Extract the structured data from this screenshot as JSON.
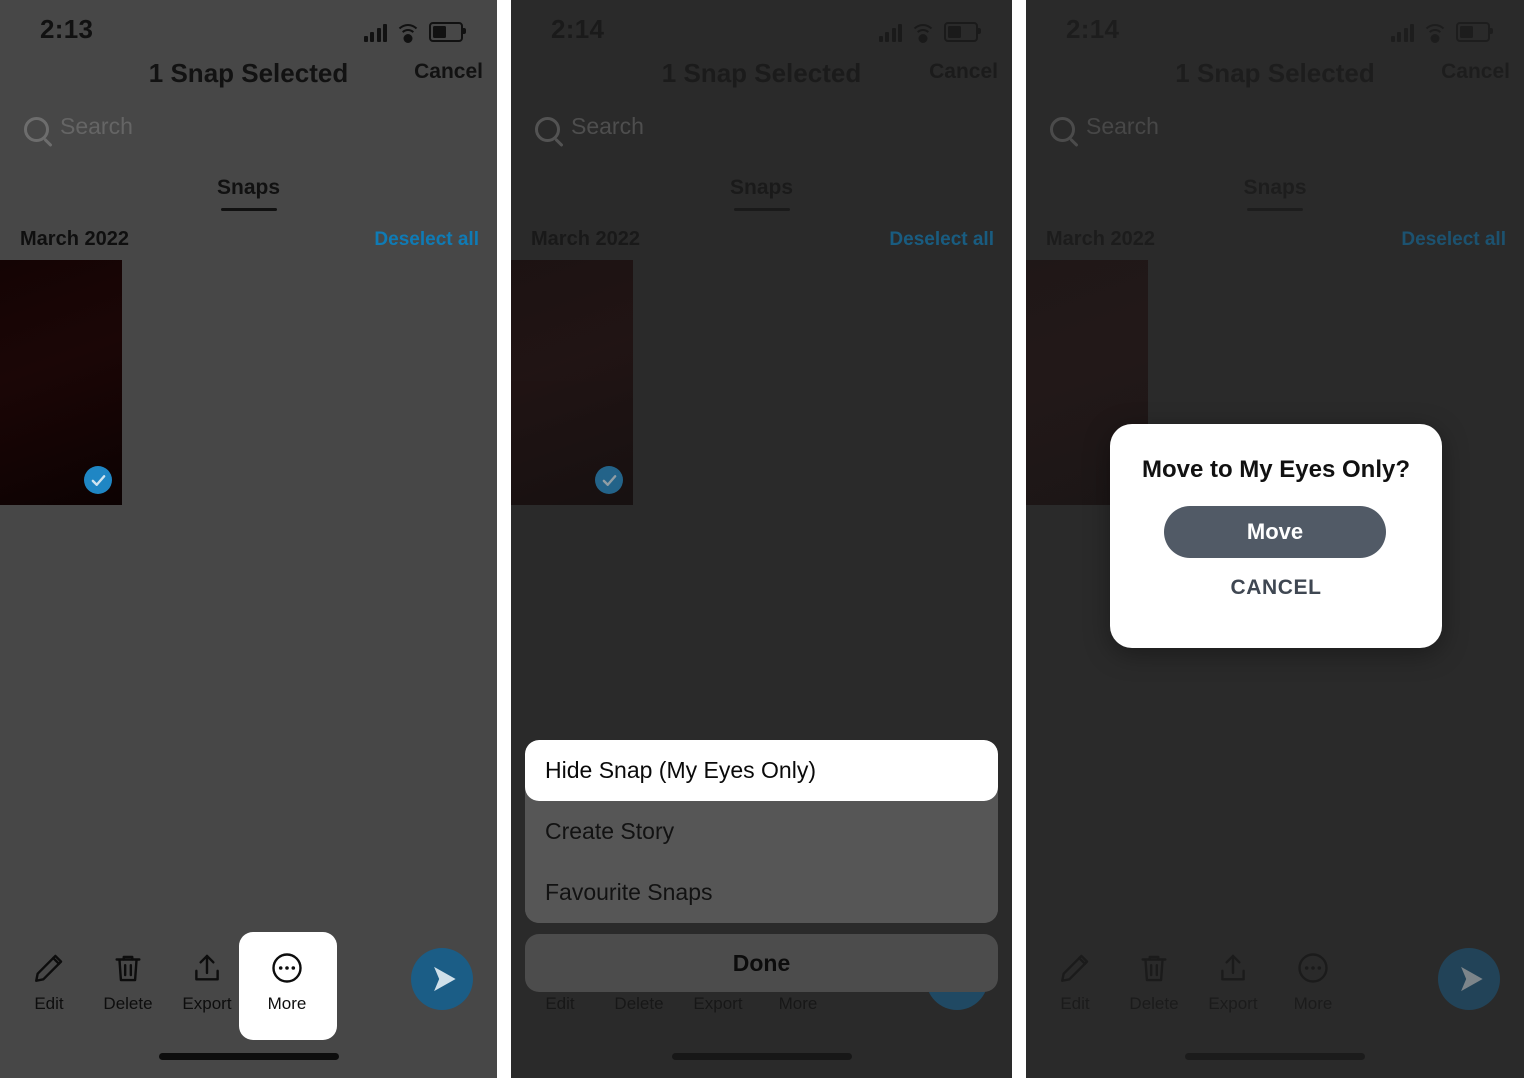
{
  "panels": [
    {
      "id": "panel-1",
      "status": {
        "time": "2:13",
        "signal_icon": "cellular-bars-icon",
        "wifi_icon": "wifi-icon",
        "battery_icon": "battery-icon"
      },
      "nav": {
        "title": "1 Snap Selected",
        "cancel_label": "Cancel"
      },
      "search": {
        "placeholder": "Search",
        "icon": "search-icon"
      },
      "tab": {
        "label": "Snaps"
      },
      "section": {
        "month": "March 2022",
        "deselect_label": "Deselect all"
      },
      "thumbnail": {
        "selected": true,
        "check_icon": "checkmark-icon"
      },
      "toolbar": {
        "items": [
          {
            "label": "Edit",
            "icon": "pencil-icon"
          },
          {
            "label": "Delete",
            "icon": "trash-icon"
          },
          {
            "label": "Export",
            "icon": "share-upload-icon"
          },
          {
            "label": "More",
            "icon": "ellipsis-circle-icon"
          }
        ],
        "send_icon": "send-arrow-icon",
        "highlighted": "More"
      }
    },
    {
      "id": "panel-2",
      "status": {
        "time": "2:14"
      },
      "nav": {
        "title": "1 Snap Selected",
        "cancel_label": "Cancel"
      },
      "search": {
        "placeholder": "Search"
      },
      "tab": {
        "label": "Snaps"
      },
      "section": {
        "month": "March 2022",
        "deselect_label": "Deselect all"
      },
      "sheet": {
        "items": [
          {
            "label": "Hide Snap (My Eyes Only)",
            "highlighted": true
          },
          {
            "label": "Create Story",
            "highlighted": false
          },
          {
            "label": "Favourite Snaps",
            "highlighted": false
          }
        ],
        "done_label": "Done"
      }
    },
    {
      "id": "panel-3",
      "status": {
        "time": "2:14"
      },
      "nav": {
        "title": "1 Snap Selected",
        "cancel_label": "Cancel"
      },
      "search": {
        "placeholder": "Search"
      },
      "tab": {
        "label": "Snaps"
      },
      "section": {
        "month": "March 2022",
        "deselect_label": "Deselect all"
      },
      "toolbar": {
        "items": [
          {
            "label": "Edit",
            "icon": "pencil-icon"
          },
          {
            "label": "Delete",
            "icon": "trash-icon"
          },
          {
            "label": "Export",
            "icon": "share-upload-icon"
          },
          {
            "label": "More",
            "icon": "ellipsis-circle-icon"
          }
        ],
        "send_icon": "send-arrow-icon"
      },
      "modal": {
        "title": "Move to My Eyes Only?",
        "primary_label": "Move",
        "secondary_label": "CANCEL"
      }
    }
  ],
  "colors": {
    "panel1_bg": "#474747",
    "panel2_bg": "#2a2a2a",
    "panel3_bg": "#2a2a2a",
    "accent_blue": "#0f7bb5",
    "send_blue": "#1b5d86",
    "check_blue": "#1f86c4",
    "modal_button": "#515a66",
    "sheet_grey": "#565656",
    "highlight_white": "#ffffff"
  }
}
